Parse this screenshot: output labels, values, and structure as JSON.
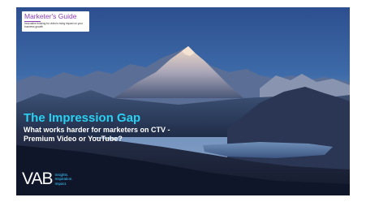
{
  "guide": {
    "title": "Marketer's Guide",
    "subtitle": "Innovative thinking for video's rising impact on your business growth"
  },
  "slide": {
    "title": "The Impression Gap",
    "subtitle": "What works harder for marketers on CTV - Premium Video or YouTube?"
  },
  "logo": {
    "name": "VAB",
    "taglines": [
      "Insights.",
      "Inspiration.",
      "Impact."
    ]
  },
  "colors": {
    "title_accent": "#2ad0f2",
    "guide_accent": "#8b3fb5",
    "tagline_accent": "#3ec8ff"
  }
}
